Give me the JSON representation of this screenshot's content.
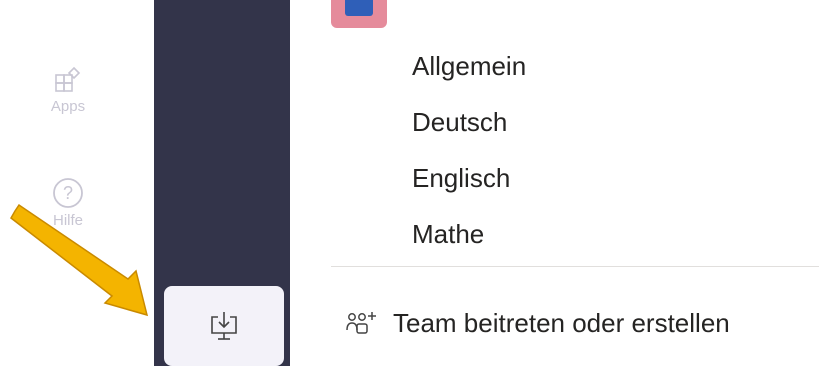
{
  "rail": {
    "apps": {
      "label": "Apps",
      "icon": "apps-icon"
    },
    "help": {
      "label": "Hilfe",
      "icon": "help-icon"
    },
    "download": {
      "icon": "download-desktop-icon"
    }
  },
  "channels": [
    "Allgemein",
    "Deutsch",
    "Englisch",
    "Mathe"
  ],
  "join_team": {
    "label": "Team beitreten oder erstellen",
    "icon": "join-team-icon"
  },
  "colors": {
    "rail_bg": "#33344a",
    "arrow": "#f4b400",
    "team_avatar": "#e58b9b",
    "team_avatar_inner": "#2f5fb8"
  }
}
